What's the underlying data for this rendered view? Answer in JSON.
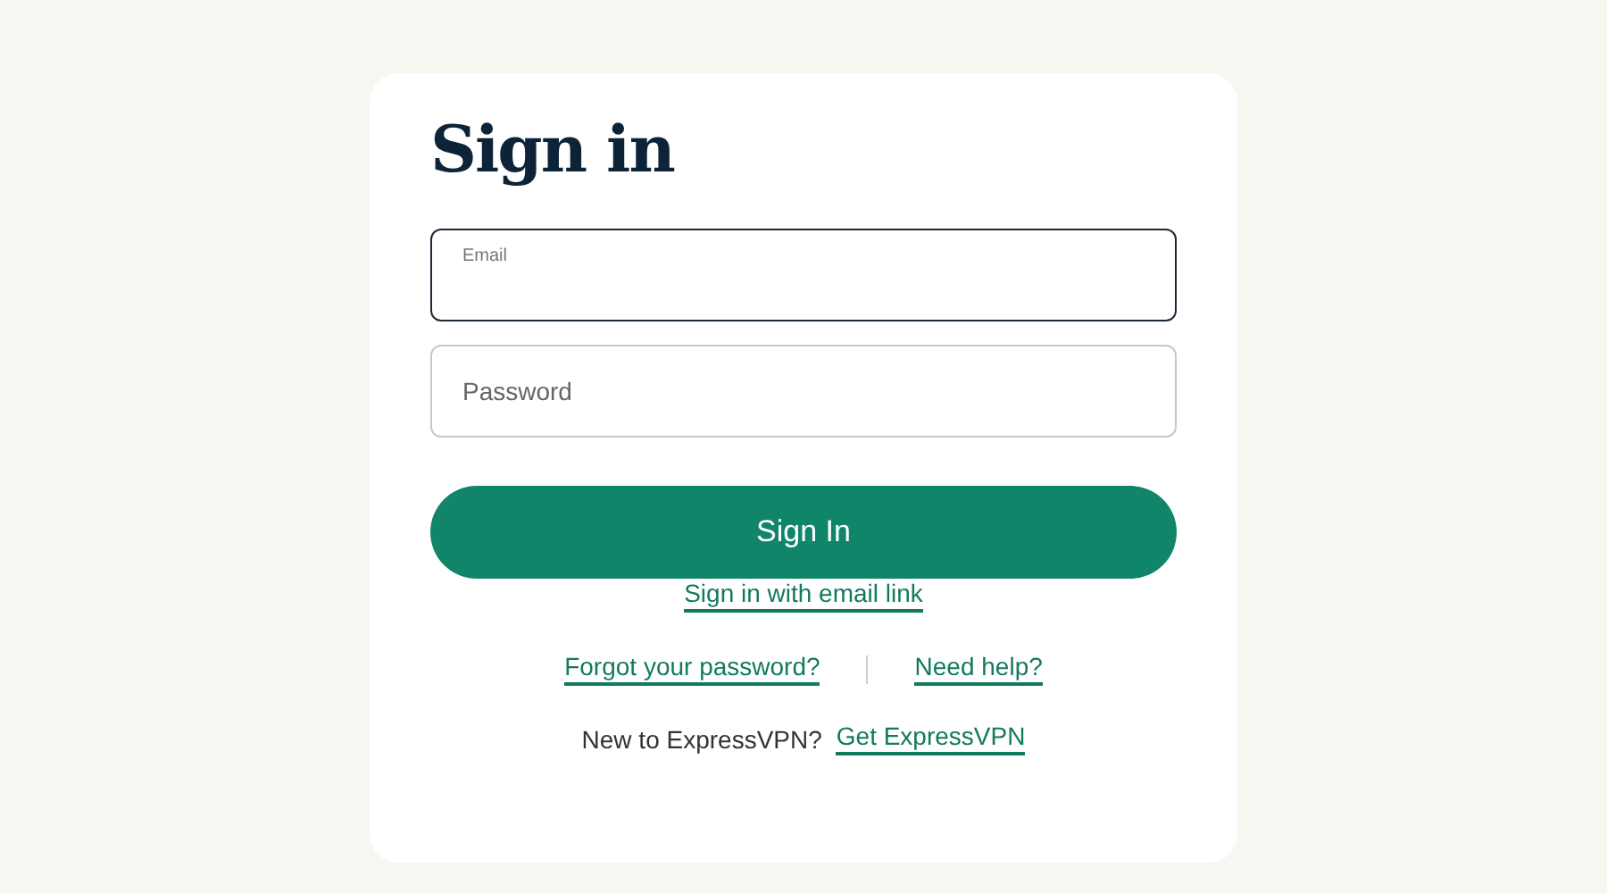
{
  "title": "Sign in",
  "fields": [
    {
      "label": "Email",
      "focused": true
    },
    {
      "placeholder": "Password",
      "focused": false
    }
  ],
  "submit": "Sign In",
  "email_link": "Sign in with email link",
  "help_links": [
    "Forgot your password?",
    "Need help?"
  ],
  "signup": {
    "text": "New to ExpressVPN?",
    "link": "Get ExpressVPN"
  }
}
